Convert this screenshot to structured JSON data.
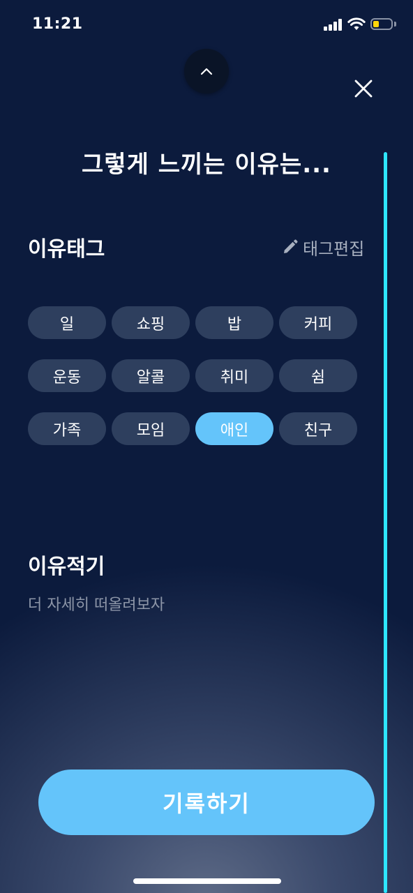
{
  "status_bar": {
    "time": "11:21"
  },
  "header": {
    "title": "그렇게 느끼는 이유는...",
    "collapse_icon": "chevron-up-icon",
    "close_icon": "close-icon"
  },
  "tags_section": {
    "heading": "이유태그",
    "edit_label": "태그편집",
    "edit_icon": "pencil-icon",
    "tags": [
      "일",
      "쇼핑",
      "밥",
      "커피",
      "운동",
      "알콜",
      "취미",
      "쉼",
      "가족",
      "모임",
      "애인",
      "친구"
    ],
    "selected": "애인"
  },
  "reason_section": {
    "heading": "이유적기",
    "placeholder": "더 자세히 떠올려보자"
  },
  "submit": {
    "label": "기록하기"
  },
  "colors": {
    "background": "#0c1b3d",
    "tag": "#2e3f5e",
    "accent": "#64c4fa",
    "scroll_indicator": "#2ee6ff"
  }
}
